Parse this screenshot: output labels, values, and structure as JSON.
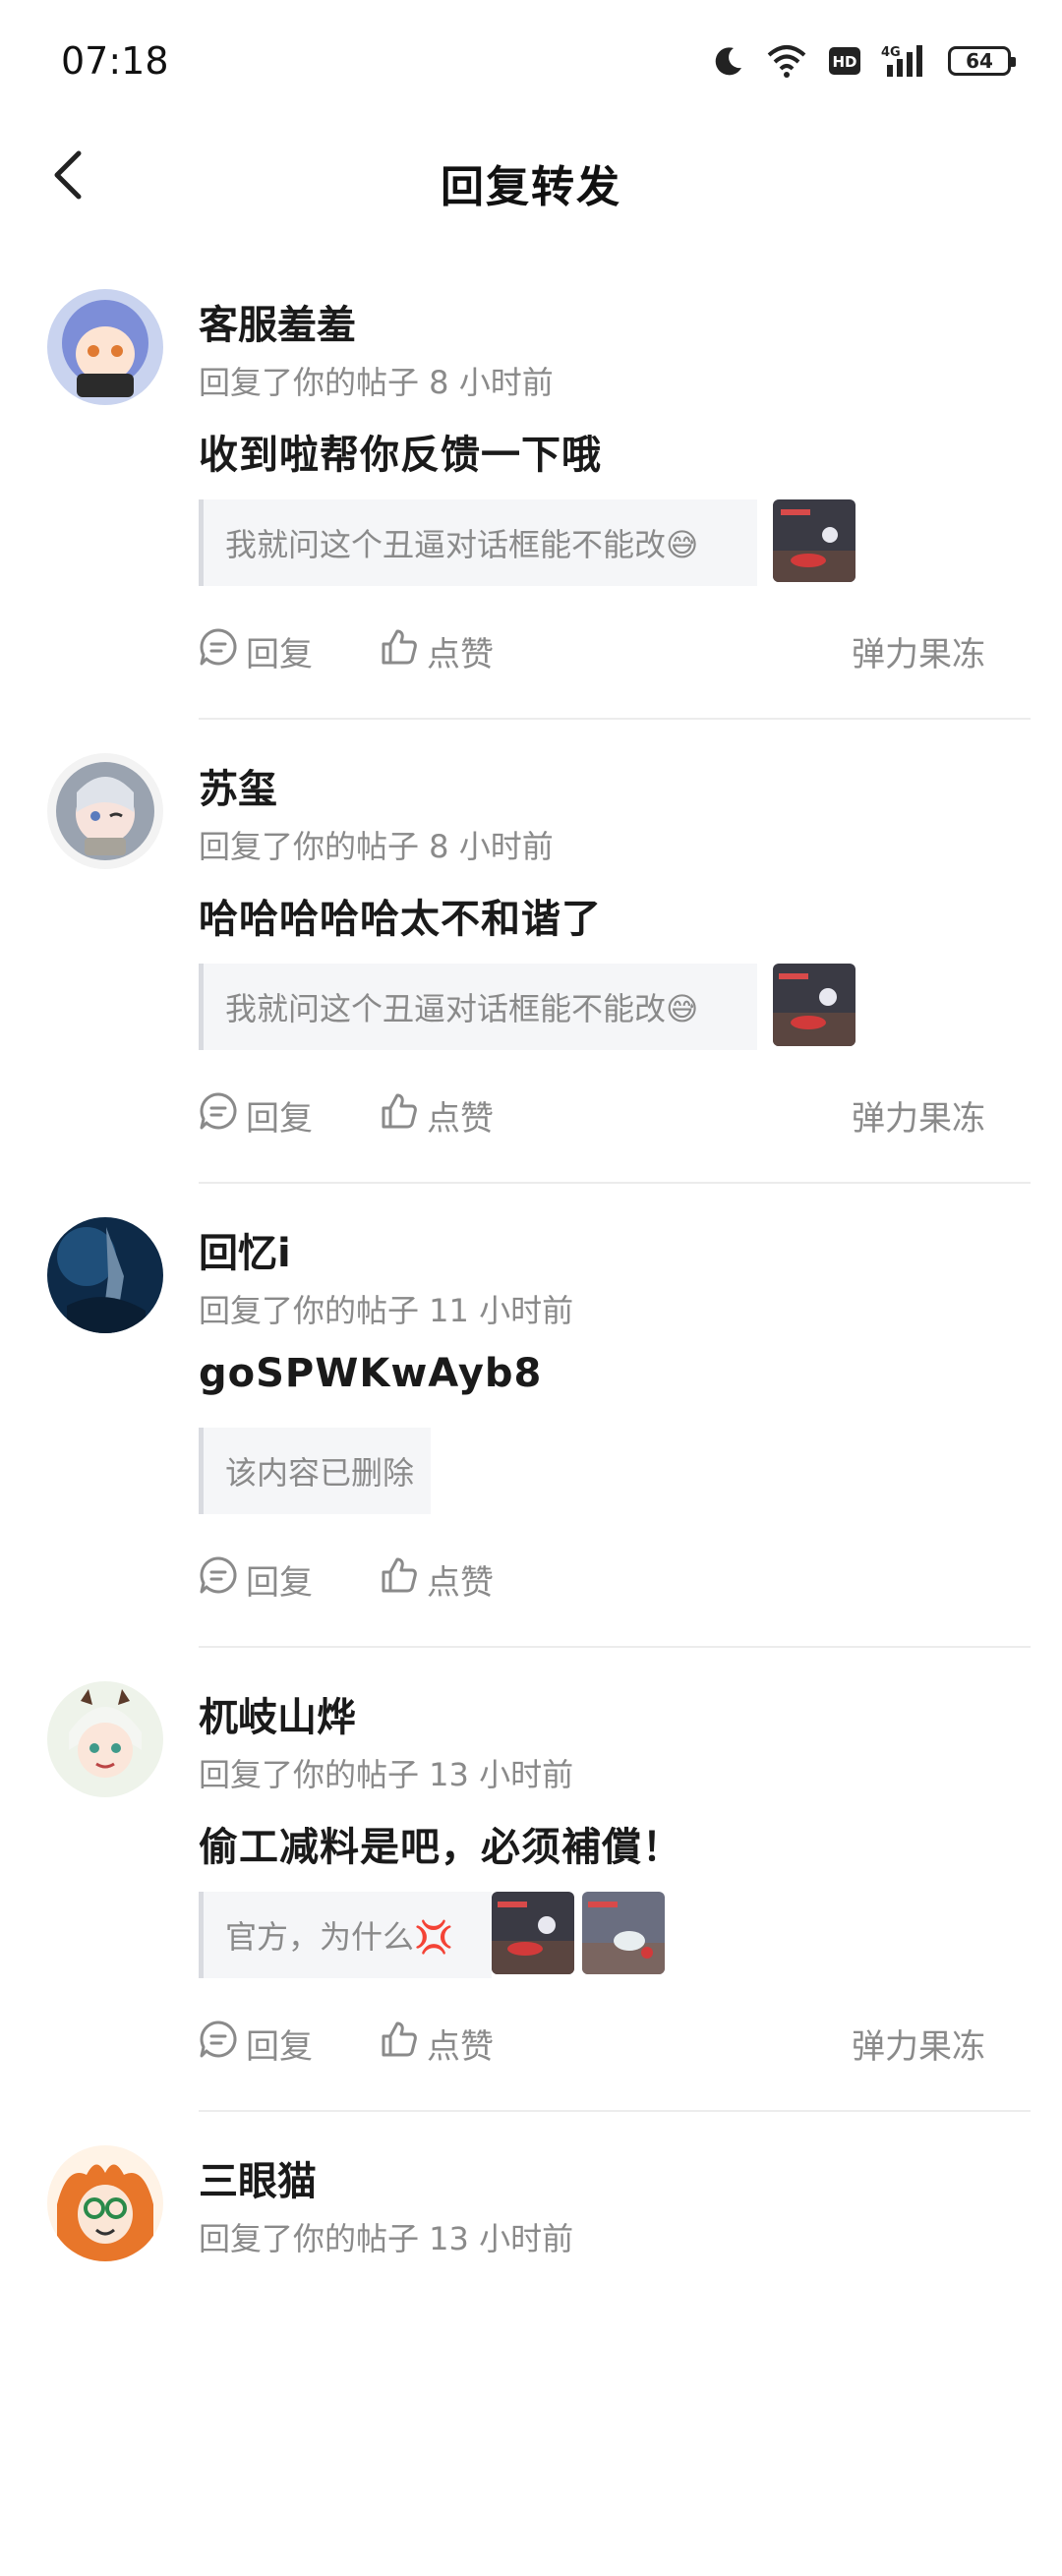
{
  "status_bar": {
    "time": "07:18",
    "battery": "64",
    "network": "4G",
    "hd_label": "HD"
  },
  "header": {
    "title": "回复转发",
    "back_icon": "chevron-left-icon"
  },
  "feed": {
    "items": [
      {
        "username": "客服羞羞",
        "meta": "回复了你的帖子 8 小时前",
        "content": "收到啦帮你反馈一下哦",
        "quote": "我就问这个丑逼对话框能不能改😅",
        "reply_label": "回复",
        "like_label": "点赞",
        "game_label": "弹力果冻"
      },
      {
        "username": "苏玺",
        "meta": "回复了你的帖子 8 小时前",
        "content": "哈哈哈哈哈太不和谐了",
        "quote": "我就问这个丑逼对话框能不能改😅",
        "reply_label": "回复",
        "like_label": "点赞",
        "game_label": "弹力果冻"
      },
      {
        "username": "回忆i",
        "meta": "回复了你的帖子 11 小时前",
        "content": "goSPWKwAyb8",
        "quote": "该内容已删除",
        "reply_label": "回复",
        "like_label": "点赞",
        "game_label": ""
      },
      {
        "username": "杌岐山烨",
        "meta": "回复了你的帖子 13 小时前",
        "content": "偷工减料是吧，必须補償！",
        "quote": "官方，为什么💢",
        "reply_label": "回复",
        "like_label": "点赞",
        "game_label": "弹力果冻"
      },
      {
        "username": "三眼猫",
        "meta": "回复了你的帖子 13 小时前"
      }
    ]
  },
  "colors": {
    "primary_text": "#1a1a1a",
    "secondary_text": "#8a8a8a",
    "quote_bg": "#f5f6f8",
    "quote_bar": "#d9dbe0",
    "divider": "#ececec"
  }
}
